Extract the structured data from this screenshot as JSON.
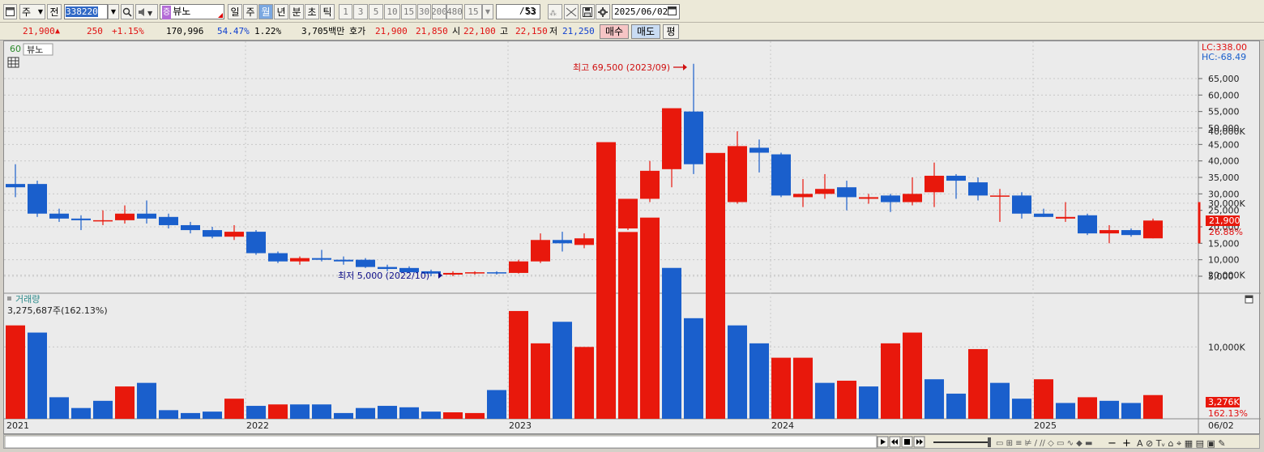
{
  "toolbar": {
    "market_label": "주",
    "jeon_label": "전",
    "code": "338220",
    "badge": "증",
    "stock_name": "뷰노",
    "periods": [
      "일",
      "주",
      "월",
      "년",
      "분",
      "초",
      "틱"
    ],
    "selected_period": "월",
    "intervals": [
      "1",
      "3",
      "5",
      "10",
      "15",
      "30",
      "200",
      "480"
    ],
    "interval_value": "15",
    "count": "53",
    "count_total": "/53",
    "date": "2025/06/02"
  },
  "quote": {
    "price": "21,900",
    "change": "250",
    "change_pct": "+1.15%",
    "volume": "170,996",
    "ratio": "54.47%",
    "turnover": "1.22%",
    "amount": "3,705백만",
    "hoga_label": "호가",
    "ask": "21,900",
    "bid": "21,850",
    "open_label": "시",
    "open": "22,100",
    "high_label": "고",
    "high": "22,150",
    "low_label": "저",
    "low": "21,250",
    "buy_label": "매수",
    "sell_label": "매도",
    "eval_label": "평"
  },
  "colors": {
    "up": "#e8180c",
    "down": "#1a5fcc",
    "bg": "#ebebeb"
  },
  "chart_data": [
    {
      "type": "candlestick",
      "title": "뷰노",
      "badge": "60",
      "legend": "top-left",
      "ylim": [
        0,
        70000
      ],
      "y_ticks": [
        "5,000",
        "10,000",
        "15,000",
        "20,000",
        "25,000",
        "30,000",
        "35,000",
        "40,000",
        "45,000",
        "50,000",
        "55,000",
        "60,000",
        "65,000"
      ],
      "x_year_labels": [
        "2021",
        "2022",
        "2023",
        "2024",
        "2025"
      ],
      "last_date_label": "06/02",
      "lc_label": "LC:338.00",
      "hc_label": "HC:-68.49",
      "max_note": "최고 69,500 (2023/09)",
      "min_note": "최저 5,000 (2022/10)",
      "price_tag": "21,900",
      "pct_tag": "26.88%",
      "candles": [
        {
          "o": 33000,
          "h": 39000,
          "l": 29000,
          "c": 32000
        },
        {
          "o": 33000,
          "h": 34000,
          "l": 23000,
          "c": 24000
        },
        {
          "o": 24000,
          "h": 25500,
          "l": 21500,
          "c": 22500
        },
        {
          "o": 22500,
          "h": 23500,
          "l": 19000,
          "c": 22000
        },
        {
          "o": 22000,
          "h": 25000,
          "l": 20500,
          "c": 22000
        },
        {
          "o": 22000,
          "h": 26500,
          "l": 21000,
          "c": 24000
        },
        {
          "o": 24000,
          "h": 28000,
          "l": 21000,
          "c": 22500
        },
        {
          "o": 23000,
          "h": 24000,
          "l": 19500,
          "c": 20500
        },
        {
          "o": 20500,
          "h": 21500,
          "l": 18000,
          "c": 19000
        },
        {
          "o": 19000,
          "h": 20000,
          "l": 16500,
          "c": 17000
        },
        {
          "o": 17000,
          "h": 20500,
          "l": 16000,
          "c": 18500
        },
        {
          "o": 18500,
          "h": 19000,
          "l": 11500,
          "c": 12000
        },
        {
          "o": 12000,
          "h": 12500,
          "l": 9000,
          "c": 9500
        },
        {
          "o": 9500,
          "h": 11000,
          "l": 8500,
          "c": 10500
        },
        {
          "o": 10500,
          "h": 13000,
          "l": 9500,
          "c": 10000
        },
        {
          "o": 10000,
          "h": 11000,
          "l": 8500,
          "c": 9500
        },
        {
          "o": 10000,
          "h": 10500,
          "l": 7500,
          "c": 7800
        },
        {
          "o": 7800,
          "h": 8500,
          "l": 6500,
          "c": 7200
        },
        {
          "o": 7500,
          "h": 8000,
          "l": 6000,
          "c": 6200
        },
        {
          "o": 6500,
          "h": 7000,
          "l": 5000,
          "c": 5800
        },
        {
          "o": 5500,
          "h": 6500,
          "l": 5000,
          "c": 6000
        },
        {
          "o": 6000,
          "h": 6500,
          "l": 5500,
          "c": 6200
        },
        {
          "o": 6200,
          "h": 6500,
          "l": 5500,
          "c": 6000
        },
        {
          "o": 6000,
          "h": 10000,
          "l": 5800,
          "c": 9500
        },
        {
          "o": 9500,
          "h": 18000,
          "l": 9000,
          "c": 16000
        },
        {
          "o": 16000,
          "h": 18500,
          "l": 12500,
          "c": 15000
        },
        {
          "o": 14500,
          "h": 18000,
          "l": 13500,
          "c": 16500
        },
        {
          "o": 16000,
          "h": 22500,
          "l": 15000,
          "c": 19500
        },
        {
          "o": 19500,
          "h": 23500,
          "l": 19000,
          "c": 28500
        },
        {
          "o": 28500,
          "h": 40000,
          "l": 27500,
          "c": 37000
        },
        {
          "o": 37500,
          "h": 43500,
          "l": 32000,
          "c": 56000
        },
        {
          "o": 55000,
          "h": 69500,
          "l": 36000,
          "c": 39000
        },
        {
          "o": 38500,
          "h": 38500,
          "l": 24000,
          "c": 27500
        },
        {
          "o": 27500,
          "h": 49000,
          "l": 27000,
          "c": 44500
        },
        {
          "o": 44000,
          "h": 46500,
          "l": 36500,
          "c": 42500
        },
        {
          "o": 42000,
          "h": 42500,
          "l": 29000,
          "c": 29500
        },
        {
          "o": 29000,
          "h": 34500,
          "l": 26000,
          "c": 30000
        },
        {
          "o": 30000,
          "h": 36000,
          "l": 28500,
          "c": 31500
        },
        {
          "o": 32000,
          "h": 34000,
          "l": 25000,
          "c": 29000
        },
        {
          "o": 28500,
          "h": 30000,
          "l": 27000,
          "c": 29000
        },
        {
          "o": 29500,
          "h": 30000,
          "l": 24500,
          "c": 27500
        },
        {
          "o": 27500,
          "h": 35000,
          "l": 26500,
          "c": 30000
        },
        {
          "o": 30500,
          "h": 39500,
          "l": 26000,
          "c": 35500
        },
        {
          "o": 35500,
          "h": 36000,
          "l": 28500,
          "c": 34000
        },
        {
          "o": 33500,
          "h": 35000,
          "l": 28000,
          "c": 29500
        },
        {
          "o": 29500,
          "h": 31500,
          "l": 21500,
          "c": 29500
        },
        {
          "o": 29500,
          "h": 30500,
          "l": 22500,
          "c": 24000
        },
        {
          "o": 24000,
          "h": 25500,
          "l": 23000,
          "c": 23000
        },
        {
          "o": 22500,
          "h": 27500,
          "l": 21500,
          "c": 23000
        },
        {
          "o": 23500,
          "h": 24000,
          "l": 17500,
          "c": 18000
        },
        {
          "o": 18000,
          "h": 20500,
          "l": 15000,
          "c": 19000
        },
        {
          "o": 19000,
          "h": 19500,
          "l": 17000,
          "c": 17500
        },
        {
          "o": 16500,
          "h": 22500,
          "l": 16500,
          "c": 21900
        }
      ]
    },
    {
      "type": "bar",
      "title": "거래량",
      "subtitle": "3,275,687주(162.13%)",
      "ylim": [
        0,
        45000
      ],
      "y_ticks": [
        "10,000K",
        "20,000K",
        "30,000K",
        "40,000K"
      ],
      "vol_tag": "3,276K",
      "vol_pct_tag": "162.13%",
      "values": [
        13000,
        12000,
        3000,
        1500,
        2500,
        4500,
        5000,
        1200,
        800,
        1000,
        2800,
        1800,
        2000,
        2000,
        2000,
        800,
        1500,
        1800,
        1600,
        1000,
        900,
        800,
        4000,
        15000,
        10500,
        13500,
        10000,
        38500,
        26000,
        28000,
        21000,
        14000,
        37000,
        13000,
        10500,
        8500,
        8500,
        5000,
        5300,
        4500,
        10500,
        12000,
        5500,
        3500,
        9700,
        5000,
        2800,
        5500,
        2200,
        3000,
        2500,
        2200,
        3300
      ],
      "colors_up": [
        true,
        false,
        false,
        false,
        false,
        true,
        false,
        false,
        false,
        false,
        true,
        false,
        true,
        false,
        false,
        false,
        false,
        false,
        false,
        false,
        true,
        true,
        false,
        true,
        true,
        false,
        true,
        true,
        true,
        true,
        false,
        false,
        true,
        false,
        false,
        true,
        true,
        false,
        true,
        false,
        true,
        true,
        false,
        false,
        true,
        false,
        false,
        true,
        false,
        true,
        false,
        false,
        true
      ]
    }
  ]
}
